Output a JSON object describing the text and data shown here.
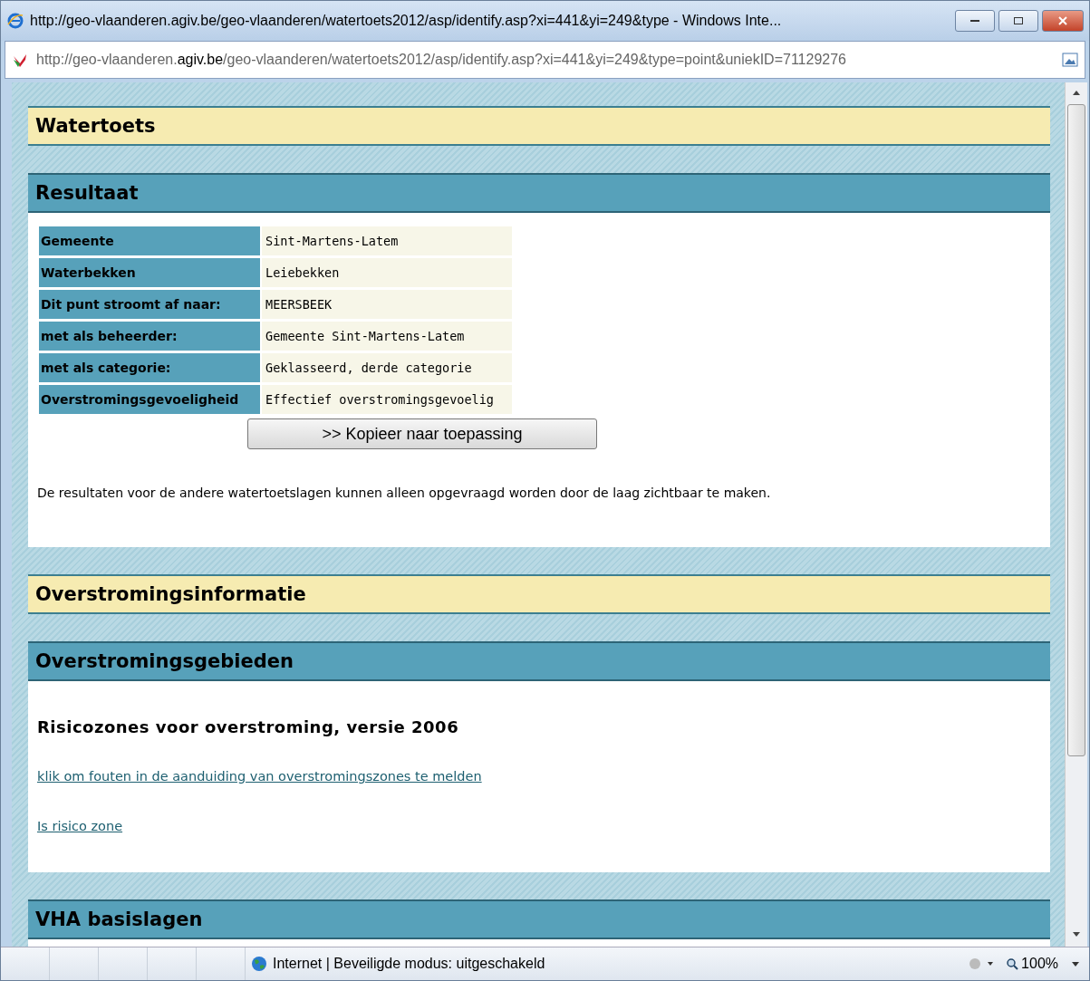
{
  "window": {
    "title": "http://geo-vlaanderen.agiv.be/geo-vlaanderen/watertoets2012/asp/identify.asp?xi=441&yi=249&type - Windows Inte..."
  },
  "address_bar": {
    "url": "http://geo-vlaanderen.**agiv.be**/geo-vlaanderen/watertoets2012/asp/identify.asp?xi=441&yi=249&type=point&uniekID=71129276"
  },
  "sections": [
    {
      "kind": "title",
      "heading": "Watertoets"
    },
    {
      "kind": "section",
      "heading": "Resultaat",
      "table": [
        {
          "label": "Gemeente",
          "value": "Sint-Martens-Latem"
        },
        {
          "label": "Waterbekken",
          "value": "Leiebekken"
        },
        {
          "label": "Dit punt stroomt af naar:",
          "value": "MEERSBEEK"
        },
        {
          "label": "met als beheerder:",
          "value": "Gemeente Sint-Martens-Latem"
        },
        {
          "label": "met als categorie:",
          "value": "Geklasseerd, derde categorie"
        },
        {
          "label": "Overstromingsgevoeligheid",
          "value": "Effectief overstromingsgevoelig"
        }
      ],
      "button": ">> Kopieer naar toepassing",
      "note": "De resultaten voor de andere watertoetslagen kunnen alleen opgevraagd worden door de laag zichtbaar te maken."
    },
    {
      "kind": "title",
      "heading": "Overstromingsinformatie"
    },
    {
      "kind": "section",
      "heading": "Overstromingsgebieden",
      "subheading": "Risicozones voor overstroming, versie 2006",
      "links": [
        "klik om fouten in de aanduiding van overstromingszones te melden",
        "Is risico zone"
      ]
    },
    {
      "kind": "section",
      "heading": "VHA basislagen"
    }
  ],
  "status_bar": {
    "zone": "Internet | Beveiligde modus: uitgeschakeld",
    "zoom": "100%"
  }
}
